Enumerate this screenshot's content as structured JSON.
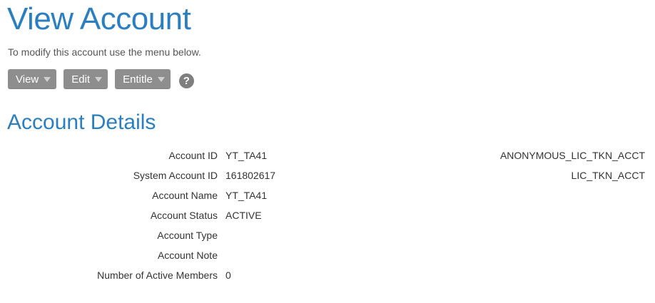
{
  "header": {
    "title": "View Account",
    "subtitle": "To modify this account use the menu below."
  },
  "menu": {
    "buttons": [
      {
        "label": "View"
      },
      {
        "label": "Edit"
      },
      {
        "label": "Entitle"
      }
    ],
    "help_glyph": "?",
    "help_icon": "help-question-icon"
  },
  "section": {
    "title": "Account Details"
  },
  "details": {
    "rows": [
      {
        "label": "Account ID",
        "value": "YT_TA41",
        "extra": "ANONYMOUS_LIC_TKN_ACCT"
      },
      {
        "label": "System Account ID",
        "value": "161802617",
        "extra": "LIC_TKN_ACCT"
      },
      {
        "label": "Account Name",
        "value": "YT_TA41",
        "extra": ""
      },
      {
        "label": "Account Status",
        "value": "ACTIVE",
        "extra": ""
      },
      {
        "label": "Account Type",
        "value": "",
        "extra": ""
      },
      {
        "label": "Account Note",
        "value": "",
        "extra": ""
      },
      {
        "label": "Number of Active Members",
        "value": "0",
        "extra": ""
      }
    ]
  },
  "colors": {
    "heading": "#2a7fc0",
    "button_bg": "#8e8e8e",
    "text": "#333333"
  }
}
